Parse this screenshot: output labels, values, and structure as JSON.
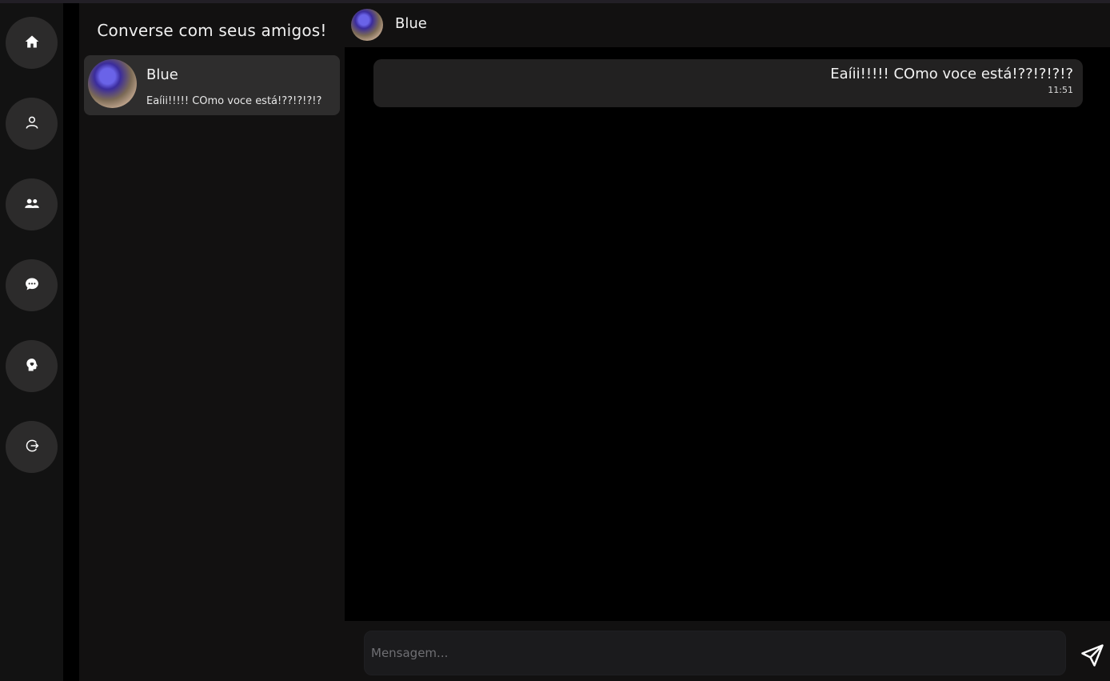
{
  "sidebar": {
    "nav": [
      {
        "icon": "home-icon"
      },
      {
        "icon": "user-icon"
      },
      {
        "icon": "users-icon"
      },
      {
        "icon": "chat-icon"
      },
      {
        "icon": "mind-icon"
      },
      {
        "icon": "logout-icon"
      }
    ]
  },
  "conversations": {
    "title": "Converse com seus amigos!",
    "items": [
      {
        "name": "Blue",
        "preview": "Eaíii!!!!! COmo voce está!??!?!?!?"
      }
    ]
  },
  "chat": {
    "header": {
      "name": "Blue"
    },
    "messages": [
      {
        "text": "Eaíii!!!!! COmo voce está!??!?!?!?",
        "time": "11:51"
      }
    ],
    "composer": {
      "placeholder": "Mensagem..."
    }
  },
  "colors": {
    "background": "#000000",
    "panel": "#121111",
    "button": "#2c2b2b",
    "selected_item": "#2e2d2d",
    "bubble": "#222121",
    "text": "#f2f2f2"
  }
}
